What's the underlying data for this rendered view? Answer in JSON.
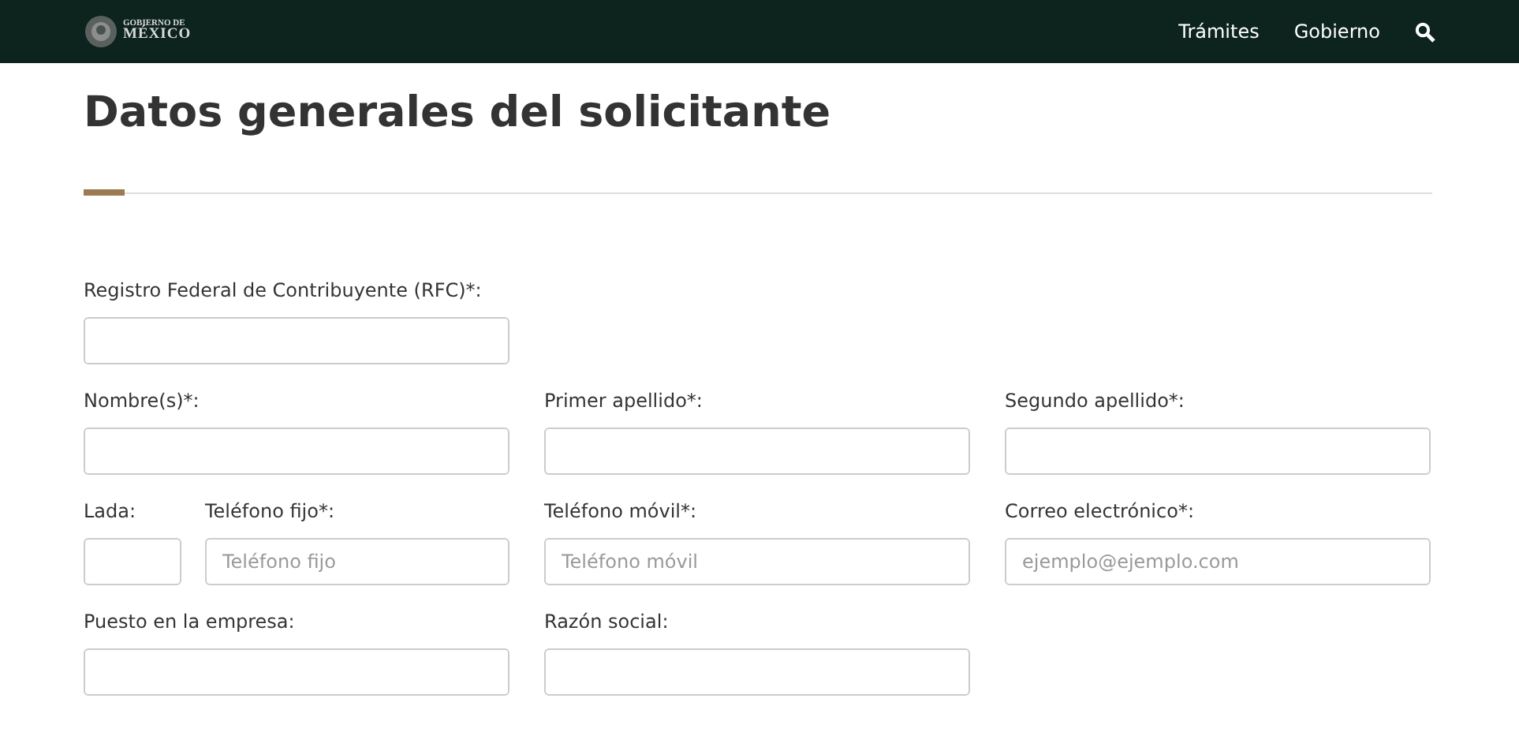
{
  "header": {
    "logo": {
      "line_1": "GOBIERNO DE",
      "line_2": "MÉXICO"
    },
    "nav": [
      "Trámites",
      "Gobierno"
    ]
  },
  "title": "Datos generales del solicitante",
  "rows": [
    [
      {
        "fields": [
          {
            "label": "Registro Federal de Contribuyente (RFC)*:"
          }
        ]
      }
    ],
    [
      {
        "fields": [
          {
            "label": "Nombre(s)*:"
          }
        ]
      },
      {
        "fields": [
          {
            "label": "Primer apellido*:"
          }
        ]
      },
      {
        "fields": [
          {
            "label": "Segundo apellido*:"
          }
        ]
      }
    ],
    [
      {
        "fields": [
          {
            "label": "Lada:",
            "kind": "short"
          },
          {
            "label": "Teléfono fijo*:",
            "placeholder": "Teléfono fijo",
            "kind": "wide"
          }
        ]
      },
      {
        "fields": [
          {
            "label": "Teléfono móvil*:",
            "placeholder": "Teléfono móvil"
          }
        ]
      },
      {
        "fields": [
          {
            "label": "Correo electrónico*:",
            "placeholder": "ejemplo@ejemplo.com"
          }
        ]
      }
    ],
    [
      {
        "fields": [
          {
            "label": "Puesto en la empresa:"
          }
        ]
      },
      {
        "fields": [
          {
            "label": "Razón social:"
          }
        ]
      }
    ]
  ]
}
